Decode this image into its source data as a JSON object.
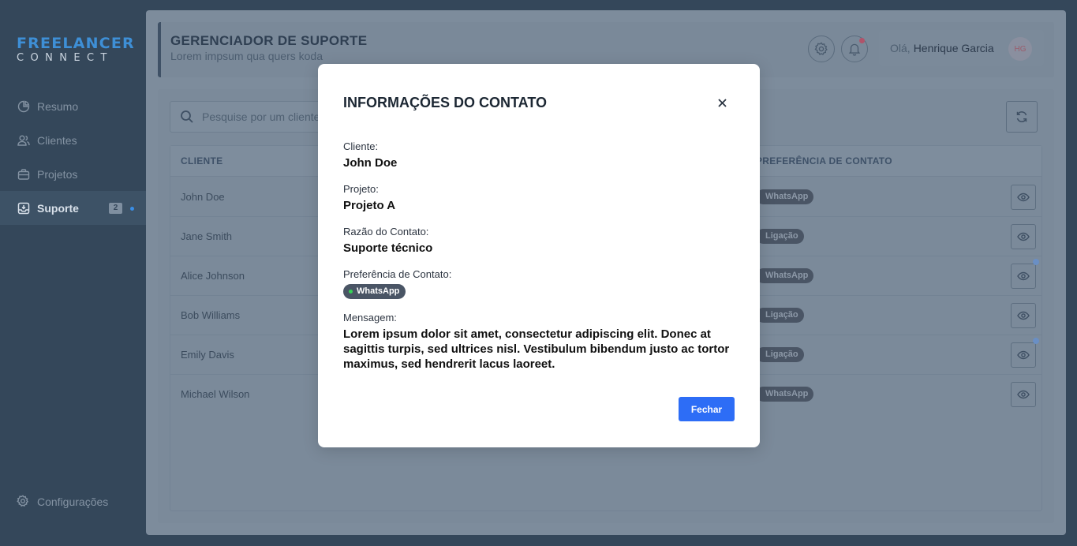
{
  "brand": {
    "line1": "FREELANCER",
    "line2": "CONNECT"
  },
  "sidebar": {
    "items": [
      {
        "label": "Resumo",
        "icon": "pie-chart-icon"
      },
      {
        "label": "Clientes",
        "icon": "users-icon"
      },
      {
        "label": "Projetos",
        "icon": "briefcase-icon"
      },
      {
        "label": "Suporte",
        "icon": "inbox-icon",
        "badge": "2",
        "active": true
      }
    ],
    "settings_label": "Configurações"
  },
  "header": {
    "title": "GERENCIADOR DE SUPORTE",
    "subtitle": "Lorem impsum qua quers koda",
    "greeting": "Olá,",
    "user_name": "Henrique Garcia",
    "avatar_initials": "HG"
  },
  "search": {
    "placeholder": "Pesquise por um cliente"
  },
  "table": {
    "columns": [
      "CLIENTE",
      "PREFERÊNCIA DE CONTATO"
    ],
    "rows": [
      {
        "client": "John Doe",
        "preference": "WhatsApp"
      },
      {
        "client": "Jane Smith",
        "preference": "Ligação"
      },
      {
        "client": "Alice Johnson",
        "preference": "WhatsApp"
      },
      {
        "client": "Bob Williams",
        "preference": "Ligação"
      },
      {
        "client": "Emily Davis",
        "preference": "Ligação"
      },
      {
        "client": "Michael Wilson",
        "preference": "WhatsApp"
      }
    ]
  },
  "modal": {
    "title": "INFORMAÇÕES DO CONTATO",
    "client_label": "Cliente:",
    "client_value": "John Doe",
    "project_label": "Projeto:",
    "project_value": "Projeto A",
    "reason_label": "Razão do Contato:",
    "reason_value": "Suporte técnico",
    "preference_label": "Preferência de Contato:",
    "preference_value": "WhatsApp",
    "message_label": "Mensagem:",
    "message_value": "Lorem ipsum dolor sit amet, consectetur adipiscing elit. Donec at sagittis turpis, sed ultrices nisl. Vestibulum bibendum justo ac tortor maximus, sed hendrerit lacus laoreet.",
    "close_button": "Fechar"
  },
  "colors": {
    "accent": "#2d6df6",
    "brand_blue": "#3e8fd6",
    "status_green": "#37d357"
  }
}
